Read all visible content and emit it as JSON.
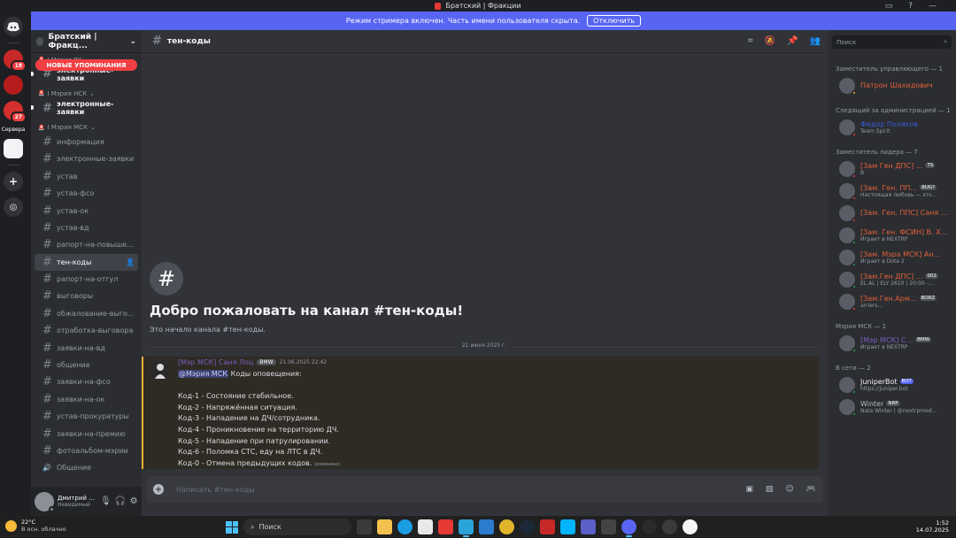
{
  "window": {
    "title": "Братский | Фракции"
  },
  "streamer_bar": {
    "text": "Режим стримера включен. Часть имени пользователя скрыта.",
    "button": "Отключить"
  },
  "guilds": [
    {
      "badge": "18",
      "color": "#c62828"
    },
    {
      "badge": "",
      "color": "#b71c1c"
    },
    {
      "badge": "27",
      "color": "#d32f2f"
    }
  ],
  "guild_folder_label": "Сервера",
  "server": {
    "name": "Братский | Фракц..."
  },
  "new_mentions": "НОВЫЕ УПОМИНАНИЯ",
  "categories": [
    {
      "label": "I Мэрия РК",
      "channels": [
        {
          "name": "электронные-заявки",
          "unread": true
        }
      ]
    },
    {
      "label": "I Мэрия НСК",
      "channels": [
        {
          "name": "электронные-заявки",
          "unread": true
        }
      ]
    },
    {
      "label": "I Мэрия МСК",
      "channels": [
        {
          "name": "информация"
        },
        {
          "name": "электронные-заявки"
        },
        {
          "name": "устав"
        },
        {
          "name": "устав-фсо"
        },
        {
          "name": "устав-ок"
        },
        {
          "name": "устав-вд"
        },
        {
          "name": "рапорт-на-повыше..."
        },
        {
          "name": "тен-коды",
          "active": true
        },
        {
          "name": "рапорт-на-отгул"
        },
        {
          "name": "выговоры"
        },
        {
          "name": "обжалование-выго..."
        },
        {
          "name": "отработка-выговора"
        },
        {
          "name": "заявки-на-вд"
        },
        {
          "name": "общение"
        },
        {
          "name": "заявки-на-фсо"
        },
        {
          "name": "заявки-на-ок"
        },
        {
          "name": "устав-прокуратуры"
        },
        {
          "name": "заявки-на-премию"
        },
        {
          "name": "фотоальбом-мэрии"
        },
        {
          "name": "Общение",
          "voice": true
        }
      ]
    }
  ],
  "user": {
    "name": "Дмитрий Евге...",
    "status": "Невидимый"
  },
  "channel": {
    "name": "тен-коды"
  },
  "welcome": {
    "title": "Добро пожаловать на канал #тен-коды!",
    "subtitle": "Это начало канала #тен-коды."
  },
  "date_divider": "21 июня 2025 г.",
  "message": {
    "author": "[Мэр МСК] Саня Лоц",
    "tag": "BMW",
    "time": "21.06.2025 22:42",
    "mention": "@Мэрия МСК",
    "intro": " Коды оповещения:",
    "lines": [
      "Код-1 - Состояние стабильное.",
      "Код-2 - Напряжённая ситуация.",
      "Код-3 - Нападение на ДЧ/сотрудника.",
      "Код-4 - Проникновение на территорию ДЧ.",
      "Код-5 - Нападение при патрулировании.",
      "Код-6 - Поломка СТС, еду на ЛТС в ДЧ.",
      "Код-0 - Отмена предыдущих кодов."
    ],
    "edited": "(изменено)"
  },
  "composer": {
    "placeholder": "Написать #тен-коды"
  },
  "search": {
    "placeholder": "Поиск"
  },
  "member_groups": [
    {
      "title": "Заместитель управляющего — 1",
      "members": [
        {
          "name": "Патрон Шахидович",
          "color": "#e0603a",
          "status_color": "#f0b232"
        }
      ]
    },
    {
      "title": "Следящий за администрацией — 1",
      "members": [
        {
          "name": "Федор Поляков",
          "sub": "Team Spirit",
          "color": "#3b5bdb",
          "status_color": "#f23f43"
        }
      ]
    },
    {
      "title": "Заместитель лидера — 7",
      "members": [
        {
          "name": "[Зам Ген ДПС] ...",
          "tag": "TS",
          "sub": "B",
          "color": "#e0603a",
          "status_color": "#f23f43"
        },
        {
          "name": "[Зам. Ген. ПП...",
          "tag": "BUG?",
          "sub": "Настоящая любовь — это...",
          "color": "#e0603a",
          "status_color": "#f23f43"
        },
        {
          "name": "[Зам. Ген. ППС] Саня ...",
          "sub": "",
          "color": "#e0603a",
          "status_color": "#f23f43"
        },
        {
          "name": "[Зам. Ген. ФСИН] В. Х...",
          "sub": "Играет в NEXTRP",
          "color": "#e0603a",
          "status_color": "#23a55a"
        },
        {
          "name": "[Зам. Мэра МСК] Ан...",
          "sub": "Играет в Dota 2",
          "color": "#e0603a",
          "status_color": "#23a55a"
        },
        {
          "name": "[Зам.Ген ДПС] ...",
          "tag": "002",
          "sub": "EL.AL | ELY 2610 | 20:00 -...",
          "color": "#e0603a",
          "status_color": "#23a55a"
        },
        {
          "name": "[Зам.Ген.Арм...",
          "tag": "BORZ",
          "sub": "arriers...",
          "color": "#e0603a",
          "status_color": "#f23f43"
        }
      ]
    },
    {
      "title": "Мэрия МСК — 1",
      "members": [
        {
          "name": "[Мэр МСК] С...",
          "tag": "BMW",
          "sub": "Играет в NEXTRP",
          "color": "#7c5cbf",
          "status_color": "#23a55a"
        }
      ]
    },
    {
      "title": "В сети — 2",
      "members": [
        {
          "name": "JuniperBot",
          "tag": "BOT",
          "sub": "https://juniper.bot",
          "color": "#f2f3f5",
          "status_color": "#23a55a",
          "bot": true
        },
        {
          "name": "Winter",
          "tag": "NRP",
          "sub": "Nata Winter | @nextrpmed...",
          "color": "#b5bac1",
          "status_color": "#23a55a"
        }
      ]
    }
  ],
  "taskbar": {
    "temp": "22°C",
    "weather": "В осн. облачно",
    "search": "Поиск",
    "time": "1:52",
    "date": "14.07.2025"
  }
}
